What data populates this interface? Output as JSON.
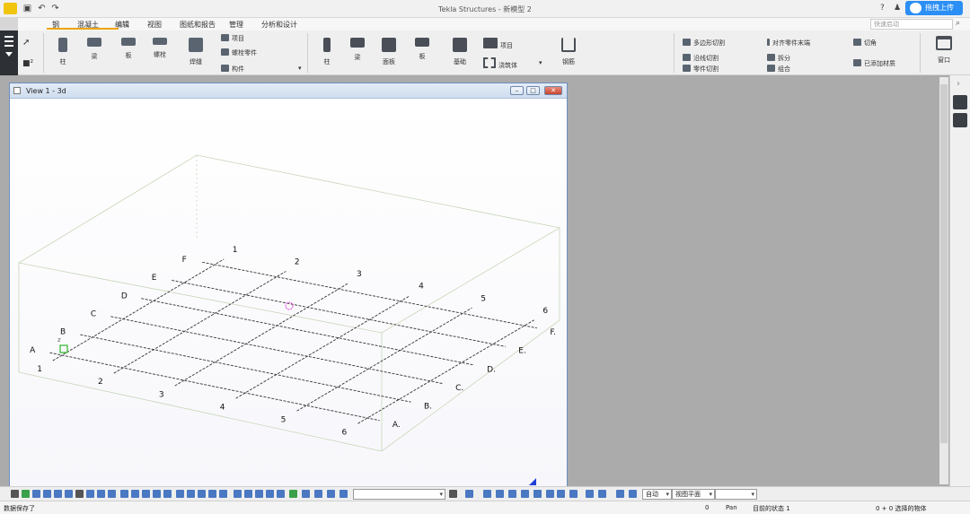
{
  "app": {
    "title": "Tekla Structures - 新模型 2",
    "upload_label": "拖拽上传",
    "help_icon": "?",
    "user_icon": "user-icon"
  },
  "menu": {
    "tabs": [
      "钢",
      "混凝土",
      "编辑",
      "视图",
      "图纸和报告",
      "管理",
      "分析和设计"
    ],
    "search_placeholder": "快速启动"
  },
  "ribbon": {
    "steel": {
      "column": "柱",
      "beam": "梁",
      "plate": "板",
      "bolt": "螺栓",
      "weld": "焊缝",
      "item": "项目",
      "bolt_part": "螺栓零件",
      "component": "构件"
    },
    "concrete": {
      "column": "柱",
      "beam": "梁",
      "wall": "面板",
      "slab": "板",
      "footing": "基础",
      "item": "项目",
      "pour": "浇筑体"
    },
    "rebar": "钢筋",
    "edit": {
      "polygon_cut": "多边形切割",
      "line_cut": "沿线切割",
      "part_cut": "零件切割",
      "fit": "对齐零件末端",
      "split": "拆分",
      "combine": "组合",
      "chamfer": "切角",
      "add_material": "已添加材质"
    },
    "window": "窗口"
  },
  "view": {
    "title": "View 1 - 3d",
    "grid": {
      "letters": [
        "A",
        "B",
        "C",
        "D",
        "E",
        "F"
      ],
      "numbers": [
        "1",
        "2",
        "3",
        "4",
        "5",
        "6"
      ],
      "z_label": "z"
    }
  },
  "toolbar": {
    "snap_mode": "自动",
    "plane": "视图平面",
    "empty_combo": ""
  },
  "status": {
    "message": "数据保存了",
    "count": "0",
    "mode": "Pan",
    "state": "目前的状态 1",
    "selection": "0 + 0 选择的物体"
  }
}
